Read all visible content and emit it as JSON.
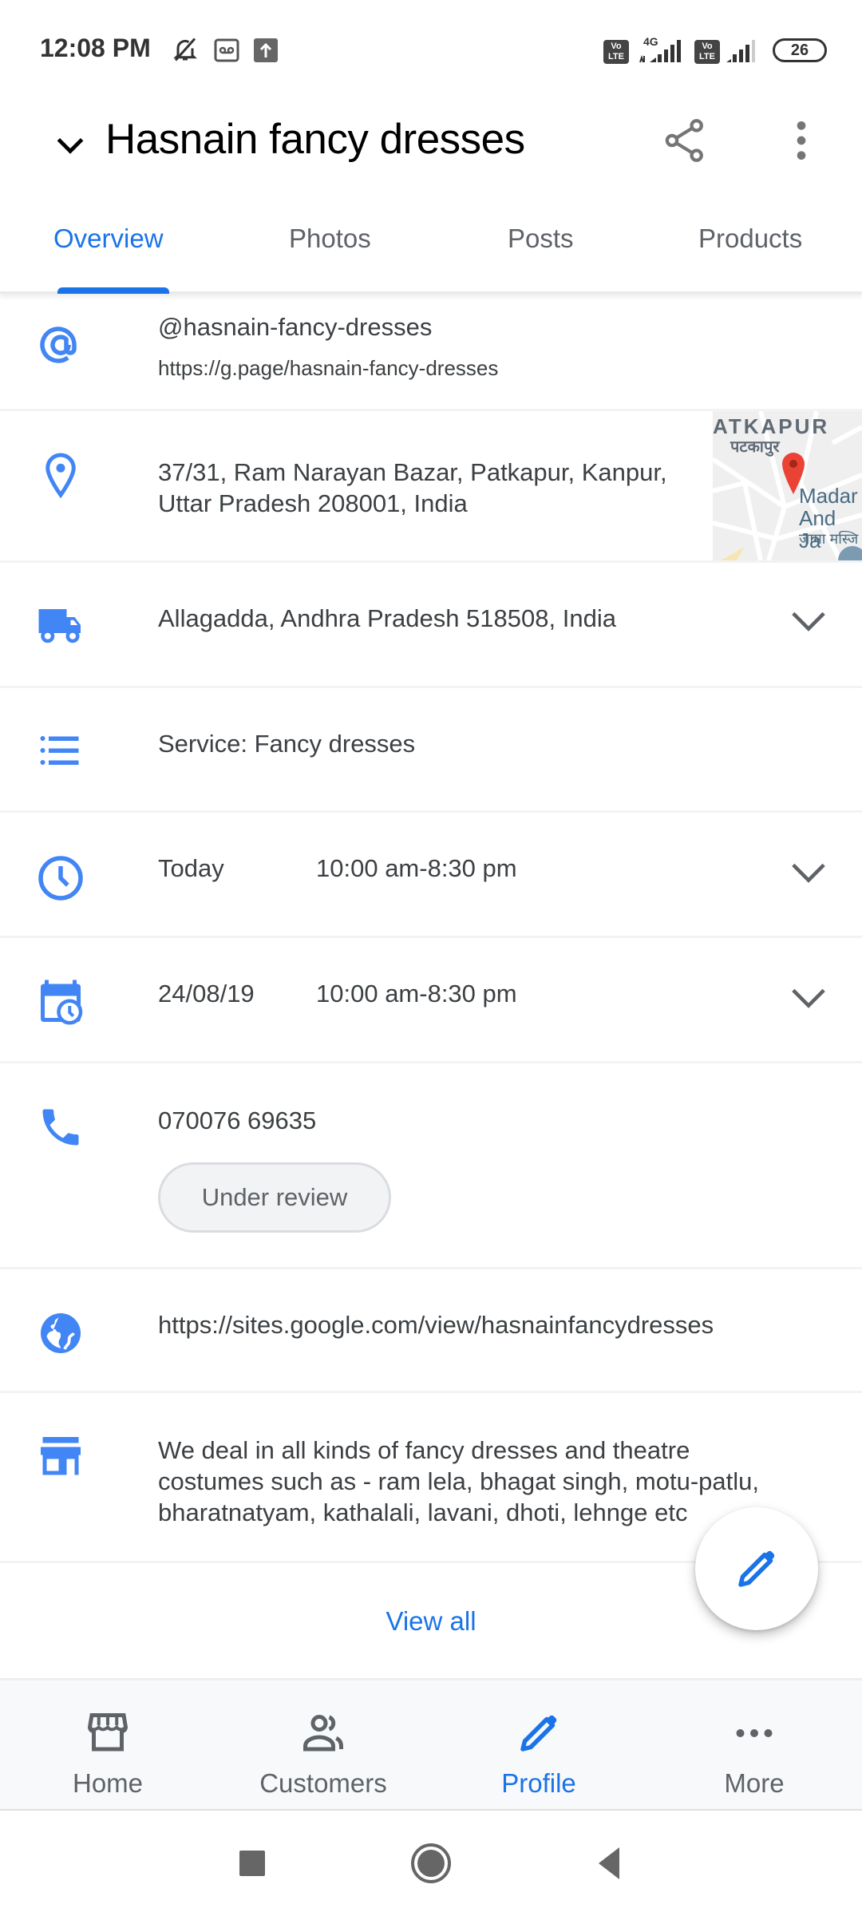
{
  "status_bar": {
    "time": "12:08 PM",
    "icons": [
      "bell-off-icon",
      "voicemail-icon",
      "upload-icon"
    ],
    "network_left": {
      "volte": "Vo LTE",
      "type": "4G"
    },
    "network_right": {
      "volte": "Vo LTE"
    },
    "battery": "26"
  },
  "header": {
    "title": "Hasnain fancy dresses",
    "collapse_icon": "chevron-down-icon",
    "share_icon": "share-icon",
    "more_icon": "more-vert-icon"
  },
  "tabs": [
    {
      "label": "Overview",
      "active": true
    },
    {
      "label": "Photos",
      "active": false
    },
    {
      "label": "Posts",
      "active": false
    },
    {
      "label": "Products",
      "active": false
    }
  ],
  "details": {
    "short_name": {
      "icon": "at-sign-icon",
      "handle": "@hasnain-fancy-dresses",
      "link": "https://g.page/hasnain-fancy-dresses"
    },
    "address": {
      "icon": "location-pin-icon",
      "line1": "37/31, Ram Narayan Bazar, Patkapur, Kanpur,",
      "line2": "Uttar Pradesh 208001, India",
      "map": {
        "label_en": "ATKAPUR",
        "label_hi": "पटकापुर",
        "poi_line1": "Madar",
        "poi_line2": "And Ja",
        "poi_hi": "जामा मस्जि"
      }
    },
    "service_area": {
      "icon": "delivery-truck-icon",
      "text": "Allagadda, Andhra Pradesh 518508, India"
    },
    "services": {
      "icon": "list-icon",
      "text": "Service: Fancy dresses"
    },
    "hours": {
      "icon": "clock-icon",
      "day": "Today",
      "time": "10:00 am-8:30 pm"
    },
    "special_hours": {
      "icon": "calendar-clock-icon",
      "date": "24/08/19",
      "time": "10:00 am-8:30 pm"
    },
    "phone": {
      "icon": "phone-icon",
      "number": "070076 69635",
      "status_chip": "Under review"
    },
    "website": {
      "icon": "globe-icon",
      "url": "https://sites.google.com/view/hasnainfancydresses"
    },
    "description": {
      "icon": "storefront-icon",
      "line1": "We deal in all kinds of fancy dresses and theatre",
      "line2": "costumes such as - ram lela, bhagat singh, motu-patlu,",
      "line3": "bharatnatyam, kathalali, lavani, dhoti, lehnge etc"
    }
  },
  "view_all_label": "View all",
  "fab": {
    "icon": "edit-pencil-icon"
  },
  "bottom_nav": [
    {
      "label": "Home",
      "icon": "storefront-icon",
      "active": false
    },
    {
      "label": "Customers",
      "icon": "people-icon",
      "active": false
    },
    {
      "label": "Profile",
      "icon": "edit-pencil-icon",
      "active": true
    },
    {
      "label": "More",
      "icon": "more-horiz-icon",
      "active": false
    }
  ],
  "system_nav": [
    "recents-button",
    "home-button",
    "back-button"
  ],
  "colors": {
    "accent": "#1a73e8",
    "icon_blue": "#4285f4",
    "text": "#3c4043",
    "secondary": "#5f6368",
    "divider": "#f1f3f4",
    "map_pin": "#ea4335"
  }
}
